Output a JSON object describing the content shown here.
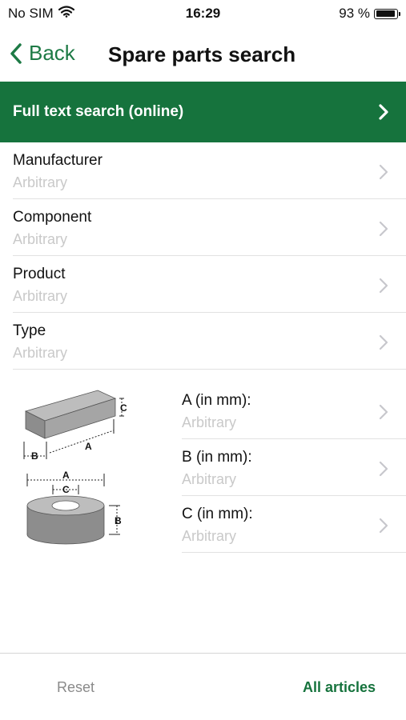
{
  "status_bar": {
    "carrier": "No SIM",
    "time": "16:29",
    "battery_text": "93 %",
    "battery_level": 0.93
  },
  "nav": {
    "back_label": "Back",
    "title": "Spare parts search"
  },
  "full_text_search": {
    "label": "Full text search (online)"
  },
  "filters": [
    {
      "label": "Manufacturer",
      "value": "Arbitrary"
    },
    {
      "label": "Component",
      "value": "Arbitrary"
    },
    {
      "label": "Product",
      "value": "Arbitrary"
    },
    {
      "label": "Type",
      "value": "Arbitrary"
    }
  ],
  "dimensions": [
    {
      "label": "A (in mm):",
      "value": "Arbitrary"
    },
    {
      "label": "B (in mm):",
      "value": "Arbitrary"
    },
    {
      "label": "C (in mm):",
      "value": "Arbitrary"
    }
  ],
  "illustration_labels": {
    "block_a": "A",
    "block_b": "B",
    "block_c": "C",
    "ring_a": "A",
    "ring_b": "B",
    "ring_c": "C"
  },
  "toolbar": {
    "reset_label": "Reset",
    "all_articles_label": "All articles"
  },
  "colors": {
    "accent": "#16733d",
    "placeholder": "#c9c9c9"
  }
}
